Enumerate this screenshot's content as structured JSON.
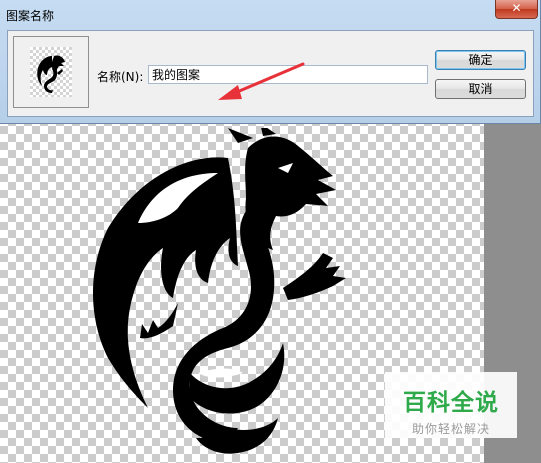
{
  "dialog": {
    "title": "图案名称",
    "close_symbol": "✕",
    "name_label": "名称(N):",
    "name_value": "我的图案",
    "ok_label": "确定",
    "cancel_label": "取消"
  },
  "watermark": {
    "title": "百科全说",
    "subtitle": "助你轻松解决"
  },
  "icons": {
    "close": "close-icon",
    "annotation": "red-arrow-icon",
    "pattern": "dragon-pattern-icon"
  },
  "colors": {
    "accent_green": "#2eaa4a",
    "arrow_red": "#e8323a",
    "close_red": "#c0391f"
  }
}
